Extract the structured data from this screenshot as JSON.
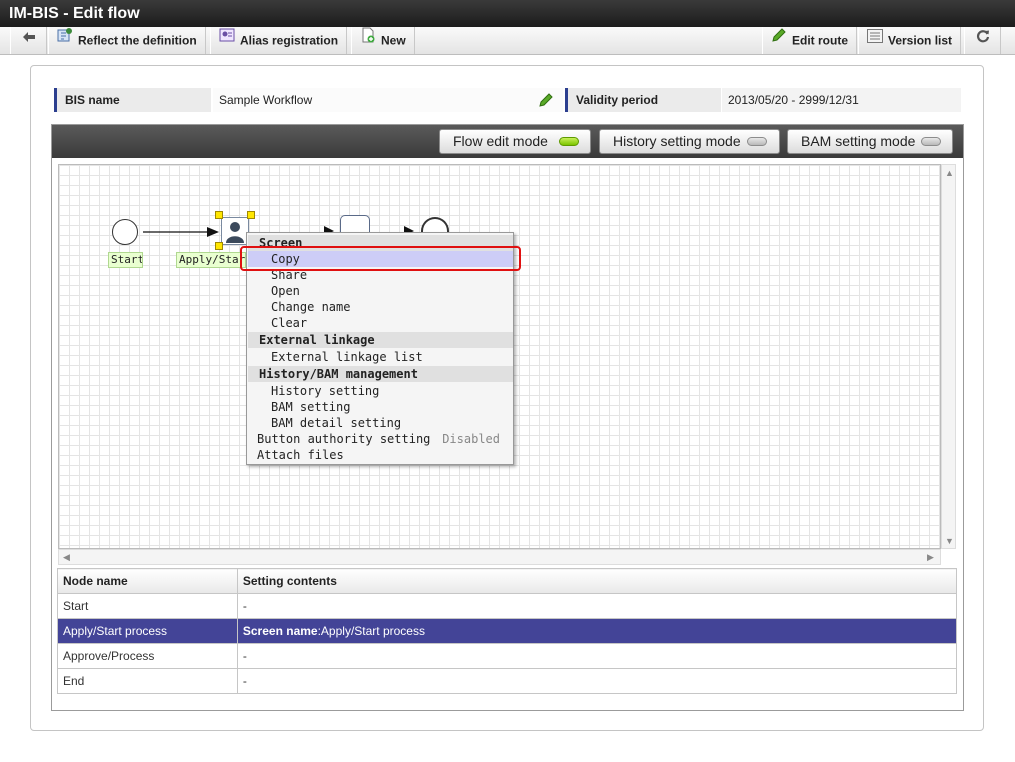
{
  "window": {
    "title": "IM-BIS - Edit flow"
  },
  "toolbar": {
    "back_icon": "arrow-left-icon",
    "reflect": "Reflect the definition",
    "alias": "Alias registration",
    "new": "New",
    "edit_route": "Edit route",
    "version_list": "Version list",
    "refresh_icon": "refresh-icon"
  },
  "info": {
    "bis_name_label": "BIS name",
    "bis_name_value": "Sample Workflow",
    "validity_label": "Validity period",
    "validity_value": "2013/05/20  -  2999/12/31"
  },
  "modes": {
    "flow": "Flow edit mode",
    "history": "History setting mode",
    "bam": "BAM setting mode",
    "active": "flow"
  },
  "flow": {
    "start_label": "Start",
    "apply_label": "Apply/Start process"
  },
  "context_menu": {
    "screen_header": "Screen",
    "copy": "Copy",
    "share": "Share",
    "open": "Open",
    "change_name": "Change name",
    "clear": "Clear",
    "external_header": "External linkage",
    "external_list": "External linkage list",
    "history_header": "History/BAM management",
    "history_setting": "History setting",
    "bam_setting": "BAM setting",
    "bam_detail": "BAM detail setting",
    "button_authority": "Button authority setting",
    "button_authority_state": "Disabled",
    "attach_files": "Attach files"
  },
  "table": {
    "headers": {
      "node": "Node name",
      "setting": "Setting contents"
    },
    "rows": [
      {
        "node": "Start",
        "setting": "-"
      },
      {
        "node": "Apply/Start process",
        "setting_key": "Screen name",
        "setting_value": ":Apply/Start process"
      },
      {
        "node": "Approve/Process",
        "setting": "-"
      },
      {
        "node": "End",
        "setting": "-"
      }
    ]
  },
  "colors": {
    "title_bar": "#1c1c1c",
    "accent": "#2c3f8f",
    "selected_row": "#434497",
    "menu_selection": "#cdcdf7",
    "highlight_box": "#e01010",
    "led_on": "#7bc400"
  }
}
